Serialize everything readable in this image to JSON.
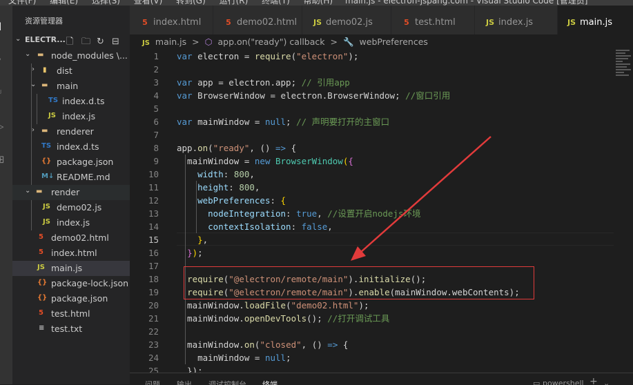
{
  "titlebar": {
    "menus": [
      "文件(F)",
      "编辑(E)",
      "选择(S)",
      "查看(V)",
      "转到(G)",
      "运行(R)",
      "终端(T)",
      "帮助(H)"
    ],
    "window_title": "main.js - electron-jspang.com - Visual Studio Code [管理员]"
  },
  "sidebar": {
    "title": "资源管理器",
    "folder": "ELECTR...",
    "items": [
      {
        "label": "node_modules \\..."
      },
      {
        "label": "dist"
      },
      {
        "label": "main"
      },
      {
        "label": "index.d.ts",
        "icon": "TS"
      },
      {
        "label": "index.js",
        "icon": "JS"
      },
      {
        "label": "renderer"
      },
      {
        "label": "index.d.ts",
        "icon": "TS"
      },
      {
        "label": "package.json",
        "icon": "{}"
      },
      {
        "label": "README.md",
        "icon": "M↓"
      },
      {
        "label": "render"
      },
      {
        "label": "demo02.js",
        "icon": "JS"
      },
      {
        "label": "index.js",
        "icon": "JS"
      },
      {
        "label": "demo02.html",
        "icon": "5"
      },
      {
        "label": "index.html",
        "icon": "5"
      },
      {
        "label": "main.js",
        "icon": "JS"
      },
      {
        "label": "package-lock.json",
        "icon": "{}"
      },
      {
        "label": "package.json",
        "icon": "{}"
      },
      {
        "label": "test.html",
        "icon": "5"
      },
      {
        "label": "test.txt",
        "icon": "≡"
      }
    ]
  },
  "tabs": [
    {
      "label": "index.html",
      "icon": "5"
    },
    {
      "label": "demo02.html",
      "icon": "5"
    },
    {
      "label": "demo02.js",
      "icon": "JS"
    },
    {
      "label": "test.html",
      "icon": "5"
    },
    {
      "label": "index.js",
      "icon": "JS"
    },
    {
      "label": "main.js",
      "icon": "JS"
    }
  ],
  "breadcrumb": {
    "file": "main.js",
    "sep": ">",
    "callback": "app.on(\"ready\") callback",
    "prop": "webPreferences"
  },
  "editor": {
    "current_line": 15,
    "lines": [
      {
        "n": "1",
        "html": "<span class=\"kw\">var</span> electron = <span class=\"fn\">require</span>(<span class=\"str\">\"electron\"</span>);"
      },
      {
        "n": "2",
        "html": ""
      },
      {
        "n": "3",
        "html": "<span class=\"kw\">var</span> app = electron.app; <span class=\"cm\">// 引用app</span>"
      },
      {
        "n": "4",
        "html": "<span class=\"kw\">var</span> BrowserWindow = electron.BrowserWindow; <span class=\"cm\">//窗口引用</span>"
      },
      {
        "n": "5",
        "html": ""
      },
      {
        "n": "6",
        "html": "<span class=\"kw\">var</span> mainWindow = <span class=\"kw\">null</span>; <span class=\"cm\">// 声明要打开的主窗口</span>"
      },
      {
        "n": "7",
        "html": ""
      },
      {
        "n": "8",
        "html": "app.<span class=\"fn\">on</span>(<span class=\"str\">\"ready\"</span>, () <span class=\"kw\">=&gt;</span> {"
      },
      {
        "n": "9",
        "html": "  mainWindow = <span class=\"kw\">new</span> <span class=\"cls\">BrowserWindow</span><span class=\"br\">(</span><span class=\"br2\">{</span>"
      },
      {
        "n": "10",
        "html": "    <span class=\"vr\">width</span>: <span class=\"nm\">800</span>,"
      },
      {
        "n": "11",
        "html": "    <span class=\"vr\">height</span>: <span class=\"nm\">800</span>,"
      },
      {
        "n": "12",
        "html": "    <span class=\"vr\">webPreferences</span>: <span class=\"br\">{</span>"
      },
      {
        "n": "13",
        "html": "      <span class=\"vr\">nodeIntegration</span>: <span class=\"kw\">true</span>, <span class=\"cm\">//设置开启nodejs环境</span>"
      },
      {
        "n": "14",
        "html": "      <span class=\"vr\">contextIsolation</span>: <span class=\"kw\">false</span>,"
      },
      {
        "n": "15",
        "html": "    <span class=\"br\">}</span>,"
      },
      {
        "n": "16",
        "html": "  <span class=\"br2\">}</span><span class=\"br\">)</span>;"
      },
      {
        "n": "17",
        "html": ""
      },
      {
        "n": "18",
        "html": "  <span class=\"fn\">require</span>(<span class=\"str\">\"@electron/remote/main\"</span>).<span class=\"fn\">initialize</span>();"
      },
      {
        "n": "19",
        "html": "  <span class=\"fn\">require</span>(<span class=\"str\">\"@electron/remote/main\"</span>).<span class=\"fn\">enable</span>(mainWindow.webContents);"
      },
      {
        "n": "20",
        "html": "  mainWindow.<span class=\"fn\">loadFile</span>(<span class=\"str\">\"demo02.html\"</span>);"
      },
      {
        "n": "21",
        "html": "  mainWindow.<span class=\"fn\">openDevTools</span>(); <span class=\"cm\">//打开调试工具</span>"
      },
      {
        "n": "22",
        "html": ""
      },
      {
        "n": "23",
        "html": "  mainWindow.<span class=\"fn\">on</span>(<span class=\"str\">\"closed\"</span>, () <span class=\"kw\">=&gt;</span> {"
      },
      {
        "n": "24",
        "html": "    mainWindow = <span class=\"kw\">null</span>;"
      },
      {
        "n": "25",
        "html": "  });"
      }
    ]
  },
  "panel": {
    "tabs": [
      "问题",
      "输出",
      "调试控制台",
      "终端"
    ],
    "terminal": "powershell",
    "add": "+",
    "chev": "⌄"
  },
  "colors": {
    "highlight_box": "#e23b3b",
    "arrow": "#e23b3b",
    "keyword": "#569cd6",
    "string": "#ce9178",
    "comment": "#6a9955"
  }
}
